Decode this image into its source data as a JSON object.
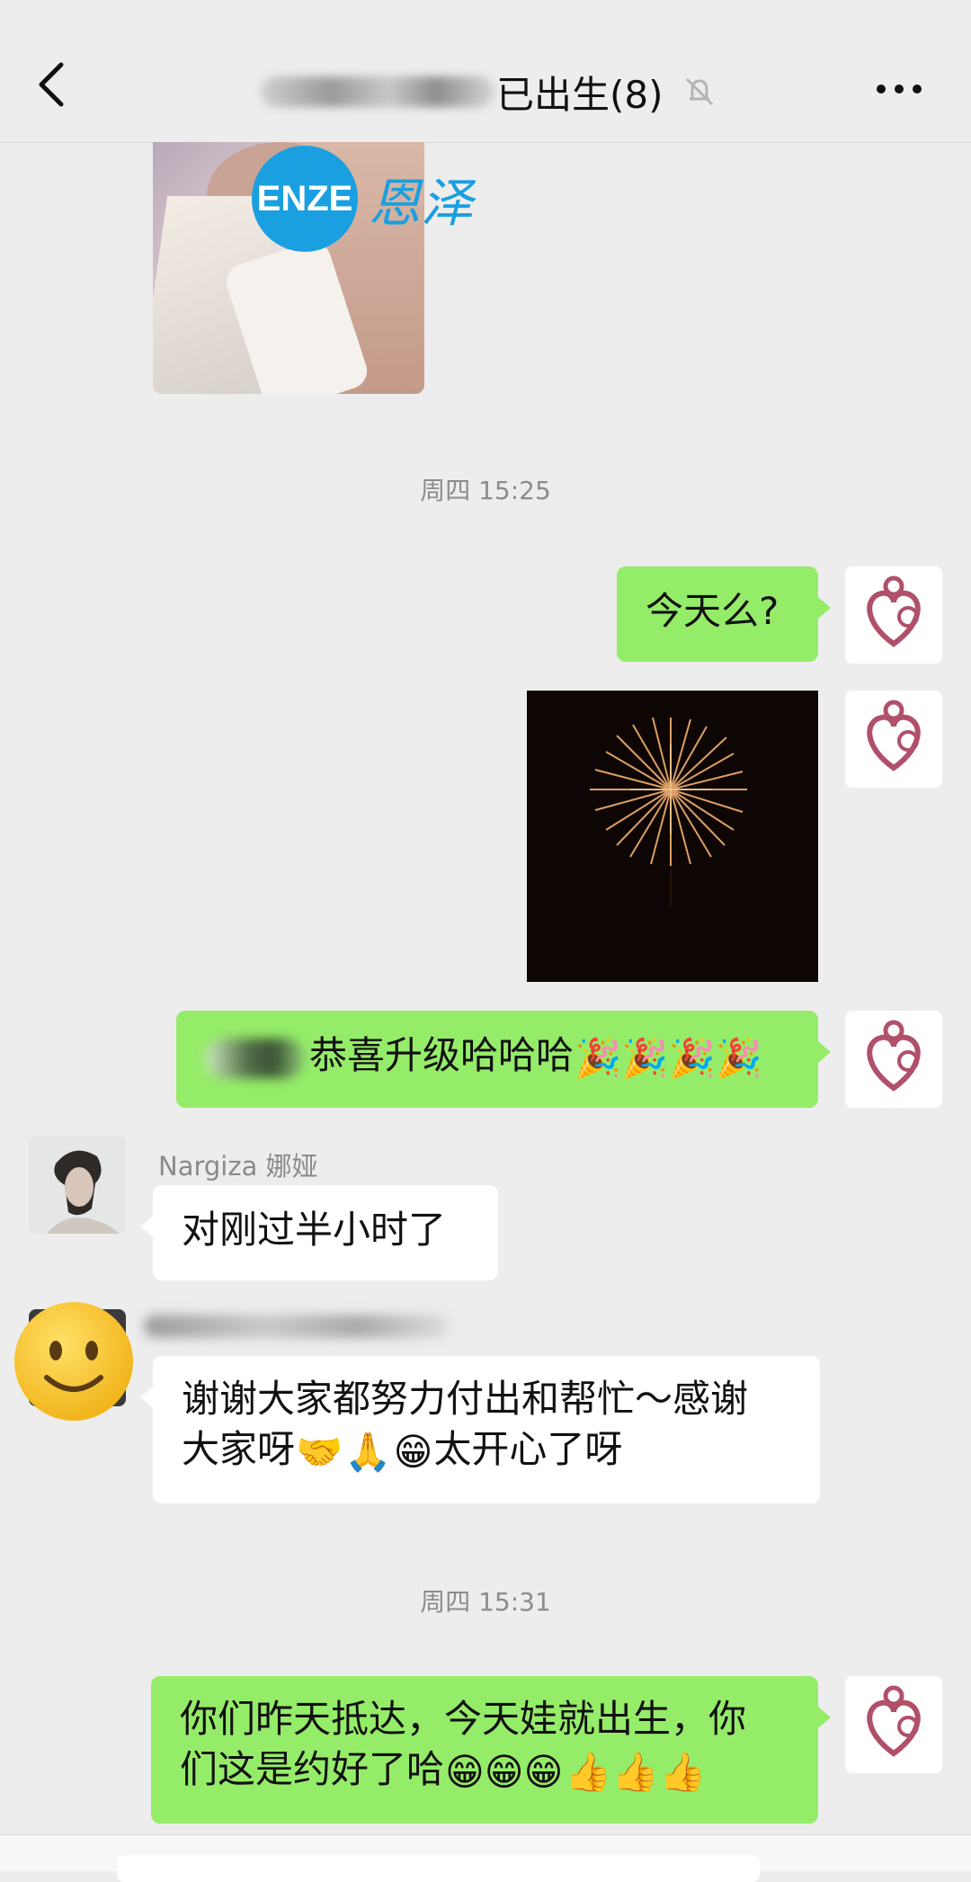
{
  "header": {
    "title_suffix": "已出生(8)",
    "back_icon": "chevron-left-icon",
    "mute_icon": "bell-muted-icon",
    "more_icon": "more-dots-icon"
  },
  "watermark": {
    "logo_text": "ENZE",
    "cn_text": "恩泽",
    "color": "#1a9fe0"
  },
  "timestamps": [
    "周四 15:25",
    "周四 15:31"
  ],
  "messages": {
    "m1": {
      "text": "今天么?"
    },
    "m3": {
      "text": "恭喜升级哈哈哈"
    },
    "m4": {
      "sender": "Nargiza 娜娅",
      "text": "对刚过半小时了"
    },
    "m5": {
      "line1": "谢谢大家都努力付出和帮忙～感谢",
      "line2_prefix": "大家呀",
      "line2_suffix": "太开心了呀"
    },
    "m6": {
      "line1": "你们昨天抵达，今天娃就出生，你",
      "line2_prefix": "们这是约好了哈"
    }
  },
  "colors": {
    "bg": "#ededed",
    "green_bubble": "#95ec69",
    "white_bubble": "#ffffff",
    "brand_avatar": "#b0506a"
  }
}
